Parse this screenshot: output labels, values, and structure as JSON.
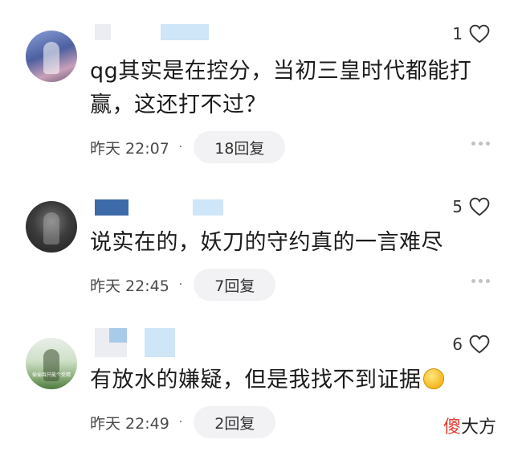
{
  "comments": [
    {
      "text": "qg其实是在控分，当初三皇时代都能打赢，这还打不过？",
      "likes": "1",
      "time": "昨天 22:07",
      "replies": "18回复",
      "avatar_icon": "user-avatar"
    },
    {
      "text": "说实在的，妖刀的守约真的一言难尽",
      "likes": "5",
      "time": "昨天 22:45",
      "replies": "7回复",
      "avatar_icon": "user-avatar"
    },
    {
      "text": "有放水的嫌疑，但是我找不到证据",
      "likes": "6",
      "time": "昨天 22:49",
      "replies": "2回复",
      "avatar_icon": "user-avatar",
      "avatar_caption": "偷偷吞只能个受精",
      "emoji": "grin-emoji"
    }
  ],
  "separator": "·",
  "watermark": {
    "accent": "傻",
    "rest": "大方"
  },
  "colors": {
    "heart_stroke": "#333333",
    "reply_pill": "#f2f2f4",
    "watermark_accent": "#e23a2e"
  }
}
